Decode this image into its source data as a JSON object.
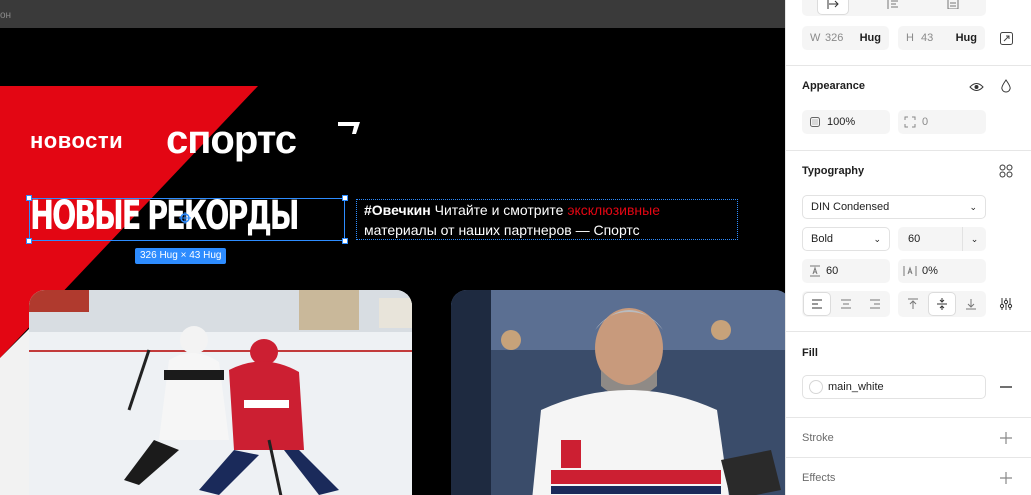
{
  "canvas": {
    "frame_label": "он",
    "brand_news": "новости",
    "brand_logo": "спортс",
    "headline": "НОВЫЕ РЕКОРДЫ",
    "size_badge": "326 Hug × 43 Hug",
    "body_tag": "#Овечкин",
    "body_before": " Читайте и смотрите ",
    "body_accent": "эксклюзивные",
    "body_line2": "материалы от наших партнеров — Спортс",
    "colors": {
      "red": "#e30613",
      "selection": "#2d8cff",
      "black": "#000000"
    }
  },
  "panel": {
    "layout": {
      "w_label": "W",
      "w_value": "326",
      "w_mode": "Hug",
      "h_label": "H",
      "h_value": "43",
      "h_mode": "Hug"
    },
    "appearance": {
      "title": "Appearance",
      "opacity": "100%",
      "radius": "0"
    },
    "typography": {
      "title": "Typography",
      "font_family": "DIN Condensed",
      "font_weight": "Bold",
      "font_size": "60",
      "line_height": "60",
      "letter_spacing": "0%"
    },
    "fill": {
      "title": "Fill",
      "swatch_name": "main_white"
    },
    "stroke": {
      "title": "Stroke"
    },
    "effects": {
      "title": "Effects"
    }
  }
}
